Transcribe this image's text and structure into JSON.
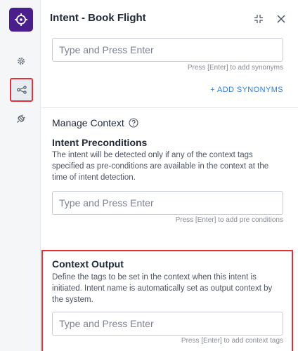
{
  "header": {
    "title": "Intent - Book Flight"
  },
  "rail": {
    "items": [
      {
        "icon": "gear-icon"
      },
      {
        "icon": "flow-icon",
        "selected": true
      },
      {
        "icon": "plug-icon"
      }
    ]
  },
  "synonyms": {
    "placeholder": "Type and Press Enter",
    "hint": "Press [Enter] to add synonyms",
    "add_label": "+ ADD SYNONYMS"
  },
  "manage_context": {
    "title": "Manage Context"
  },
  "preconditions": {
    "title": "Intent Preconditions",
    "description": "The intent will be detected only if any of the context tags specified as pre-conditions are available in the context at the time of intent detection.",
    "placeholder": "Type and Press Enter",
    "hint": "Press [Enter] to add pre conditions"
  },
  "context_output": {
    "title": "Context Output",
    "description": "Define the tags to be set in the context when this intent is initiated. Intent name is automatically set as output context by the system.",
    "placeholder": "Type and Press Enter",
    "hint": "Press [Enter] to add context tags"
  },
  "colors": {
    "logo_bg": "#4a1f8c",
    "highlight": "#e0313a",
    "link": "#2b7de9"
  }
}
